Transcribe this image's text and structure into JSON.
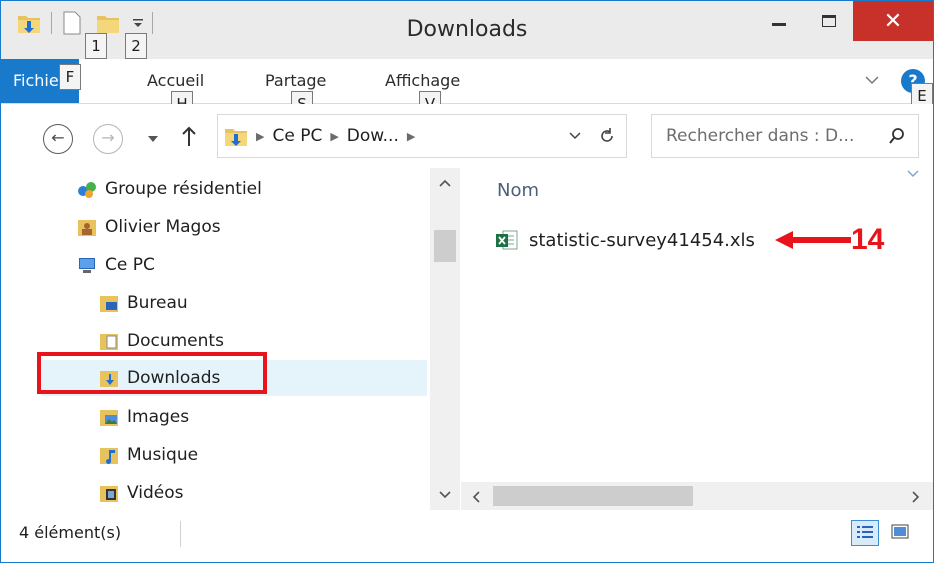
{
  "window": {
    "title": "Downloads",
    "close_glyph": "✕"
  },
  "quick_access": {
    "keytips": [
      "1",
      "2"
    ]
  },
  "ribbon": {
    "tab_file": "Fichier",
    "file_keytip": "F",
    "tabs": [
      {
        "label": "Accueil",
        "keytip": "H"
      },
      {
        "label": "Partage",
        "keytip": "S"
      },
      {
        "label": "Affichage",
        "keytip": "V"
      }
    ],
    "help_keytip": "E"
  },
  "address": {
    "crumbs": [
      "Ce PC",
      "Dow..."
    ]
  },
  "search": {
    "placeholder": "Rechercher dans : D..."
  },
  "nav_tree": [
    {
      "label": "Groupe résidentiel",
      "icon": "homegroup-icon"
    },
    {
      "label": "Olivier Magos",
      "icon": "user-folder-icon"
    },
    {
      "label": "Ce PC",
      "icon": "computer-icon"
    },
    {
      "label": "Bureau",
      "icon": "desktop-folder-icon"
    },
    {
      "label": "Documents",
      "icon": "documents-folder-icon"
    },
    {
      "label": "Downloads",
      "icon": "downloads-folder-icon",
      "selected": true
    },
    {
      "label": "Images",
      "icon": "pictures-folder-icon"
    },
    {
      "label": "Musique",
      "icon": "music-folder-icon"
    },
    {
      "label": "Vidéos",
      "icon": "videos-folder-icon"
    }
  ],
  "file_list": {
    "column": "Nom",
    "files": [
      {
        "name": "statistic-survey41454.xls",
        "icon": "excel-file-icon"
      }
    ]
  },
  "annotation": {
    "number": "14",
    "color": "#e8141b"
  },
  "status": {
    "count": "4 élément(s)"
  },
  "colors": {
    "accent": "#1979ca",
    "close": "#c7312a",
    "selection": "#e5f3fb"
  }
}
